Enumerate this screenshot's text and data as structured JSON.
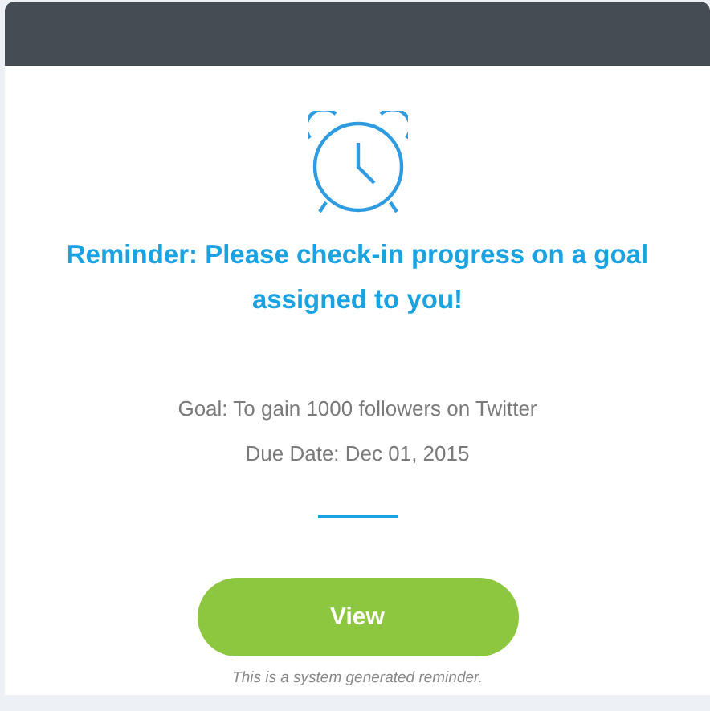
{
  "reminder": {
    "heading": "Reminder: Please check-in progress on a goal assigned to you!",
    "details": [
      "Goal: To gain 1000 followers on Twitter",
      "Due Date: Dec 01, 2015"
    ],
    "button": "View",
    "footnote": "This is a system generated reminder."
  }
}
